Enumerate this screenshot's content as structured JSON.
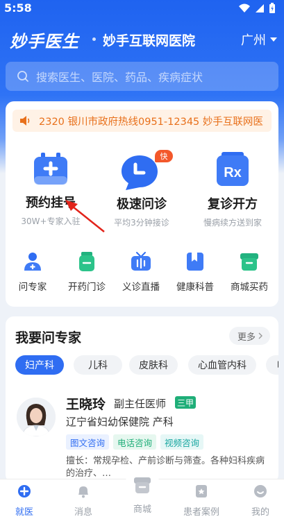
{
  "status": {
    "time": "5:58"
  },
  "header": {
    "brand": "妙手医生",
    "hospital": "妙手互联网医院",
    "city": "广州"
  },
  "search": {
    "placeholder": "搜索医生、医院、药品、疾病症状"
  },
  "notice": {
    "text": "2320  银川市政府热线0951-12345  妙手互联网医"
  },
  "services_main": [
    {
      "label": "预约挂号",
      "sub": "30W+专家入驻",
      "icon": "calendar-plus-icon"
    },
    {
      "label": "极速问诊",
      "sub": "平均3分钟接诊",
      "icon": "chat-clock-icon",
      "badge": "快"
    },
    {
      "label": "复诊开方",
      "sub": "慢病续方送到家",
      "icon": "rx-icon"
    }
  ],
  "services_small": [
    {
      "label": "问专家",
      "icon": "doctor-icon"
    },
    {
      "label": "开药门诊",
      "icon": "medicine-bottle-icon"
    },
    {
      "label": "义诊直播",
      "icon": "live-tv-icon"
    },
    {
      "label": "健康科普",
      "icon": "bookmark-icon"
    },
    {
      "label": "商城买药",
      "icon": "shop-box-icon"
    }
  ],
  "experts": {
    "title": "我要问专家",
    "more": "更多",
    "chips": [
      "妇产科",
      "儿科",
      "皮肤科",
      "心血管内科",
      "呼"
    ],
    "doctor": {
      "name": "王晓玲",
      "title": "副主任医师",
      "level": "三甲",
      "hospital": "辽宁省妇幼保健院  产科",
      "tags": [
        "图文咨询",
        "电话咨询",
        "视频咨询"
      ],
      "skill": "擅长：常规孕检、产前诊断与筛查。各种妇科疾病的治疗、…"
    }
  },
  "tabbar": [
    {
      "label": "就医",
      "active": true
    },
    {
      "label": "消息"
    },
    {
      "label": "商城"
    },
    {
      "label": "患者案例"
    },
    {
      "label": "我的"
    }
  ],
  "colors": {
    "primary": "#2f6df2",
    "notice": "#e8701b",
    "green": "#1fae78"
  }
}
